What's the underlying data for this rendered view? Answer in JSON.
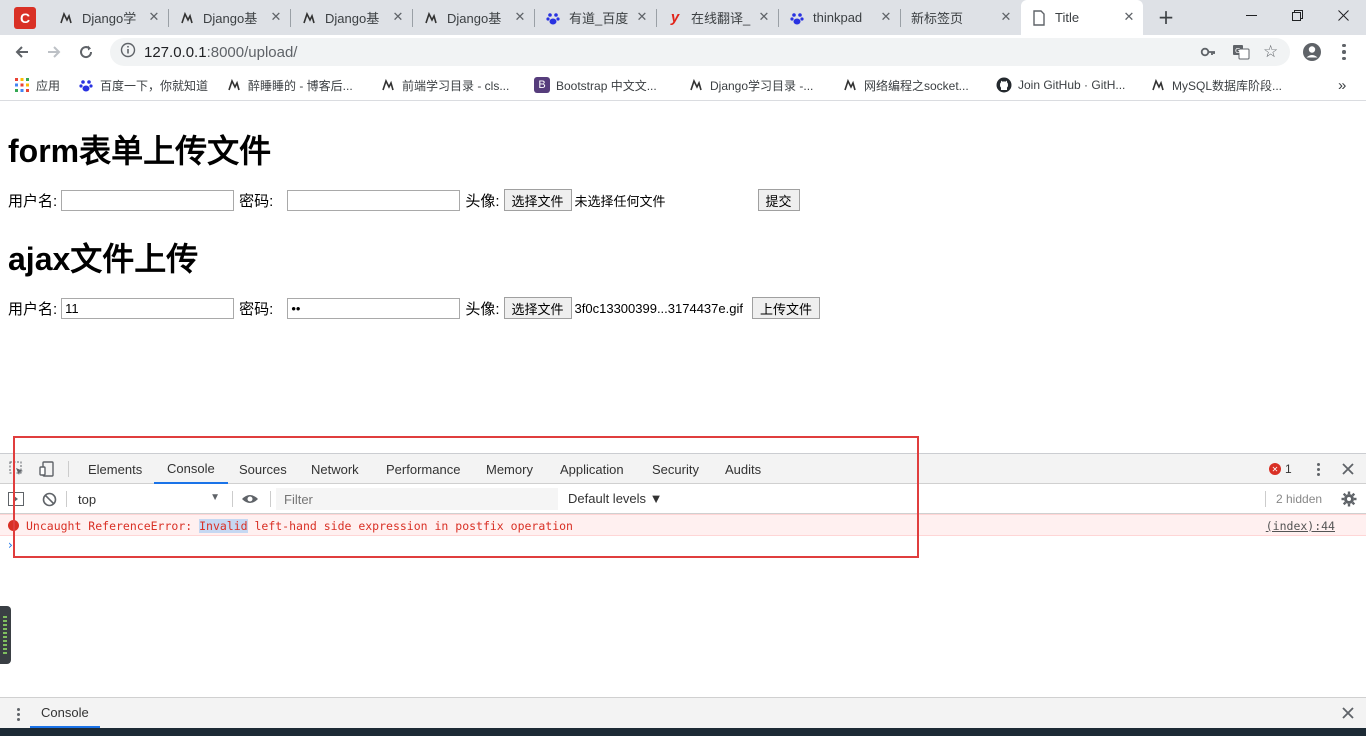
{
  "browser": {
    "tabs": [
      {
        "label": "Django学",
        "icon": "cnblogs-icon",
        "active": false
      },
      {
        "label": "Django基",
        "icon": "cnblogs-icon",
        "active": false
      },
      {
        "label": "Django基",
        "icon": "cnblogs-icon",
        "active": false
      },
      {
        "label": "Django基",
        "icon": "cnblogs-icon",
        "active": false
      },
      {
        "label": "有道_百度",
        "icon": "baidu-paw-icon",
        "active": false
      },
      {
        "label": "在线翻译_",
        "icon": "youdao-icon",
        "active": false
      },
      {
        "label": "thinkpad",
        "icon": "baidu-paw-icon",
        "active": false
      },
      {
        "label": "新标签页",
        "icon": "",
        "active": false
      },
      {
        "label": "Title",
        "icon": "page-icon",
        "active": true
      }
    ],
    "url": {
      "host": "127.0.0.1",
      "path": ":8000/upload/"
    },
    "bookmarks": [
      {
        "label": "应用",
        "icon": "apps-grid-icon"
      },
      {
        "label": "百度一下，你就知道",
        "icon": "baidu-paw-icon"
      },
      {
        "label": "醉睡睡的 - 博客后...",
        "icon": "cnblogs-icon"
      },
      {
        "label": "前端学习目录 - cls...",
        "icon": "cnblogs-icon"
      },
      {
        "label": "Bootstrap 中文文...",
        "icon": "bootstrap-icon"
      },
      {
        "label": "Django学习目录 -...",
        "icon": "cnblogs-icon"
      },
      {
        "label": "网络编程之socket...",
        "icon": "cnblogs-icon"
      },
      {
        "label": "Join GitHub · GitH...",
        "icon": "github-icon"
      },
      {
        "label": "MySQL数据库阶段...",
        "icon": "cnblogs-icon"
      }
    ],
    "more_bookmarks": "»"
  },
  "page": {
    "form_heading": "form表单上传文件",
    "ajax_heading": "ajax文件上传",
    "username_label": "用户名:",
    "password_label": "密码:",
    "avatar_label": "头像:",
    "choose_file": "选择文件",
    "form": {
      "username": "",
      "password": "",
      "file_status": "未选择任何文件",
      "submit": "提交"
    },
    "ajax": {
      "username": "11",
      "password": "••",
      "file_status": "3f0c13300399...3174437e.gif",
      "submit": "上传文件"
    }
  },
  "devtools": {
    "tabs": [
      "Elements",
      "Console",
      "Sources",
      "Network",
      "Performance",
      "Memory",
      "Application",
      "Security",
      "Audits"
    ],
    "active_tab": "Console",
    "error_count": "1",
    "context": "top",
    "filter_placeholder": "Filter",
    "levels": "Default levels ▼",
    "hidden": "2 hidden",
    "error": {
      "prefix": "Uncaught ReferenceError: ",
      "highlight": "Invalid",
      "suffix": " left-hand side expression in postfix operation",
      "source": "(index):44"
    },
    "prompt": "›",
    "drawer_tab": "Console"
  }
}
